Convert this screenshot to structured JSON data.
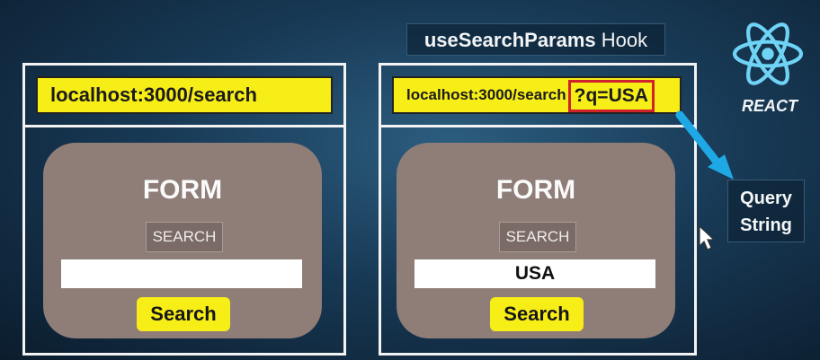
{
  "header": {
    "hook_title_bold": "useSearchParams",
    "hook_title_rest": " Hook"
  },
  "panels": {
    "left": {
      "url": "localhost:3000/search",
      "form_title": "FORM",
      "search_label": "SEARCH",
      "input_value": "",
      "button_label": "Search"
    },
    "right": {
      "url_base": "localhost:3000/search",
      "url_query": "?q=USA",
      "form_title": "FORM",
      "search_label": "SEARCH",
      "input_value": "USA",
      "button_label": "Search"
    }
  },
  "brand": {
    "react_label": "REACT",
    "icon": "react-icon"
  },
  "annotation": {
    "line1": "Query",
    "line2": "String"
  },
  "colors": {
    "url_bar": "#f7ed17",
    "query_highlight": "#d0222a",
    "form_card": "#8f7d78",
    "arrow": "#1fa8e6",
    "react_logo": "#6fd3f5"
  }
}
